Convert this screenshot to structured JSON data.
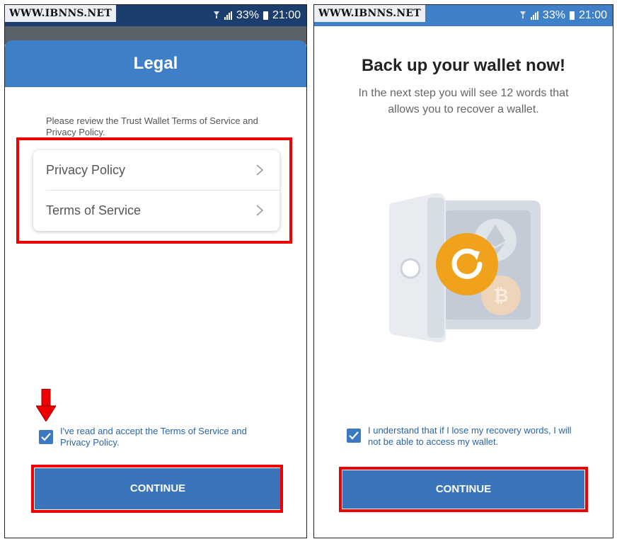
{
  "watermark": "WWW.IBNNS.NET",
  "status": {
    "battery": "33%",
    "time": "21:00"
  },
  "legal": {
    "title": "Legal",
    "intro": "Please review the Trust Wallet Terms of Service and Privacy Policy.",
    "items": [
      {
        "label": "Privacy Policy"
      },
      {
        "label": "Terms of Service"
      }
    ],
    "checkbox_label": "I've read and accept the Terms of Service and Privacy Policy.",
    "continue_label": "CONTINUE"
  },
  "backup": {
    "title": "Back up your wallet now!",
    "subtitle": "In the next step you will see 12 words that allows you to recover a wallet.",
    "checkbox_label": "I understand that if I lose my recovery words, I will not be able to access my wallet.",
    "continue_label": "CONTINUE"
  },
  "colors": {
    "primary": "#3f7fc7",
    "highlight": "#e00000",
    "orange": "#f0a020"
  }
}
